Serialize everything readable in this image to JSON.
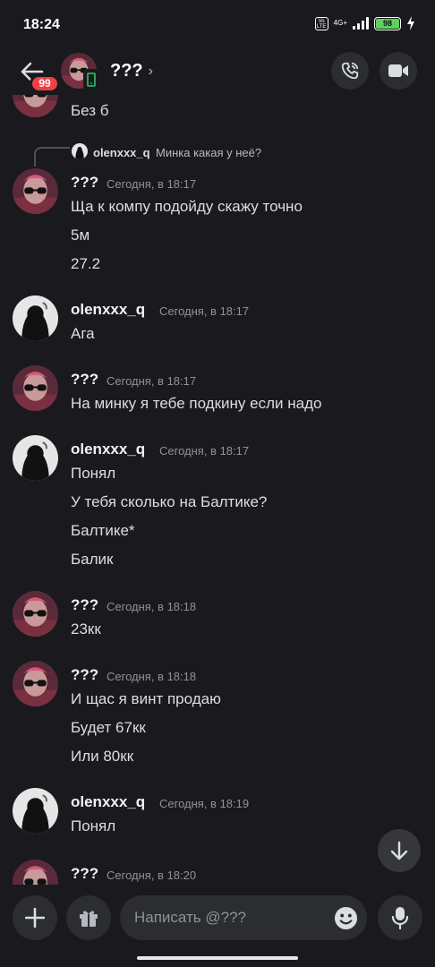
{
  "status_bar": {
    "time": "18:24",
    "volte": "Vo LTE",
    "network": "4G+",
    "battery": "98"
  },
  "header": {
    "back_badge": "99",
    "title": "???",
    "chevron": "›"
  },
  "reply": {
    "author": "olenxxx_q",
    "text": "Минка какая у неё?"
  },
  "messages": [
    {
      "author": "",
      "time": "",
      "lines": [
        "Без б"
      ]
    },
    {
      "author": "???",
      "time": "Сегодня, в 18:17",
      "lines": [
        "Ща к компу подойду скажу точно",
        "5м",
        "27.2"
      ]
    },
    {
      "author": "olenxxx_q",
      "time": "Сегодня, в 18:17",
      "lines": [
        "Ага"
      ]
    },
    {
      "author": "???",
      "time": "Сегодня, в 18:17",
      "lines": [
        "На минку я тебе подкину если надо"
      ]
    },
    {
      "author": "olenxxx_q",
      "time": "Сегодня, в 18:17",
      "lines": [
        "Понял",
        "У тебя сколько на Балтике?",
        "Балтике*",
        "Балик"
      ]
    },
    {
      "author": "???",
      "time": "Сегодня, в 18:18",
      "lines": [
        "23кк"
      ]
    },
    {
      "author": "???",
      "time": "Сегодня, в 18:18",
      "lines": [
        "И щас я винт продаю",
        "Будет 67кк",
        "Или 80кк"
      ]
    },
    {
      "author": "olenxxx_q",
      "time": "Сегодня, в 18:19",
      "lines": [
        "Понял"
      ]
    },
    {
      "author": "???",
      "time": "Сегодня, в 18:20",
      "lines": []
    }
  ],
  "composer": {
    "placeholder": "Написать @???"
  },
  "colors": {
    "background": "#1a1a1e",
    "surface": "#2b2d31",
    "badge": "#f23f43",
    "online": "#23a55a",
    "battery": "#5fd05f"
  }
}
